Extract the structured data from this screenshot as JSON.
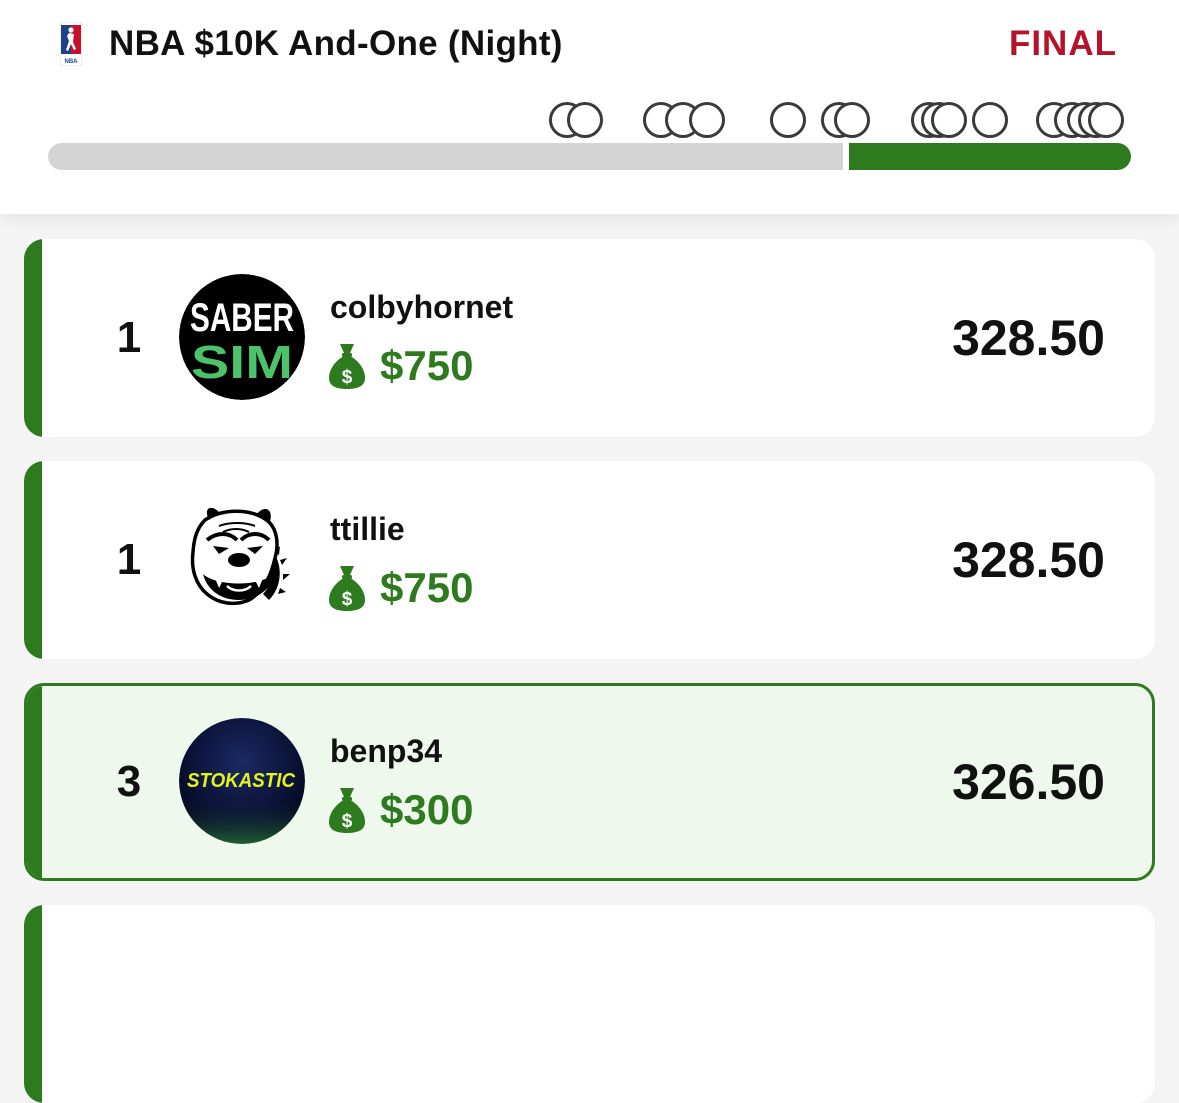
{
  "header": {
    "league_icon": "nba-logo-icon",
    "contest_title": "NBA $10K And-One (Night)",
    "status": "FINAL",
    "status_color": "#b5122b"
  },
  "progress": {
    "fraction_complete": 0.26,
    "fill_color": "#2e7a1f",
    "track_color": "#d4d4d4"
  },
  "colors": {
    "accent_green": "#2e7a1f",
    "highlight_bg": "#eef8ec",
    "prize_green": "#2e7a1f"
  },
  "leaderboard": [
    {
      "rank": "1",
      "avatar": "sabersim-logo-avatar",
      "avatar_text_top": "SABER",
      "avatar_text_bottom": "SIM",
      "username": "colbyhornet",
      "prize_icon": "money-bag-icon",
      "prize": "$750",
      "score": "328.50"
    },
    {
      "rank": "1",
      "avatar": "bulldog-avatar",
      "username": "ttillie",
      "prize_icon": "money-bag-icon",
      "prize": "$750",
      "score": "328.50"
    },
    {
      "rank": "3",
      "avatar": "stokastic-logo-avatar",
      "avatar_text": "STOKASTIC",
      "username": "benp34",
      "prize_icon": "money-bag-icon",
      "prize": "$300",
      "score": "326.50",
      "highlighted": true
    }
  ]
}
